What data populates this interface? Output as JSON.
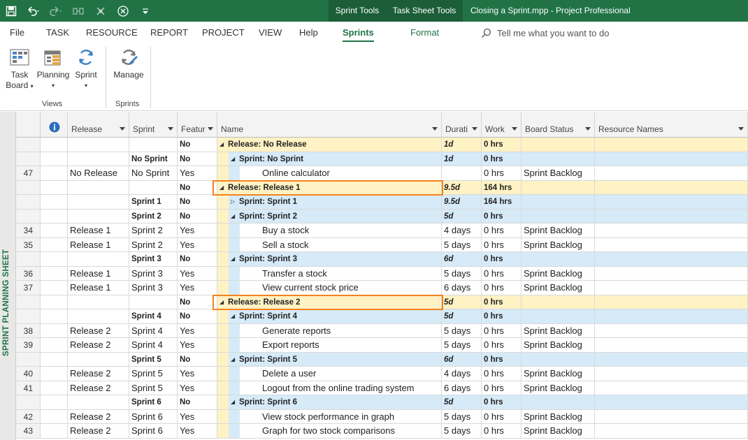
{
  "qat": {
    "icons": [
      "save-icon",
      "undo-icon",
      "redo-icon",
      "link-icon",
      "unlink-icon",
      "inspect-icon",
      "customize-icon"
    ]
  },
  "title_bar": {
    "context_tab_sprint": "Sprint Tools",
    "context_tab_tasksheet": "Task Sheet Tools",
    "title": "Closing a Sprint.mpp  -  Project Professional"
  },
  "menu": {
    "file": "File",
    "task": "TASK",
    "resource": "RESOURCE",
    "report": "REPORT",
    "project": "PROJECT",
    "view": "VIEW",
    "help": "Help",
    "sprints": "Sprints",
    "format": "Format",
    "tell_me": "Tell me what you want to do"
  },
  "ribbon": {
    "task_board_line1": "Task",
    "task_board_line2": "Board",
    "planning": "Planning",
    "sprint": "Sprint",
    "manage": "Manage",
    "group_views": "Views",
    "group_sprints": "Sprints"
  },
  "sidebar_label": "SPRINT PLANNING SHEET",
  "columns": [
    "Release",
    "Sprint",
    "Featur",
    "Name",
    "Durati",
    "Work",
    "Board Status",
    "Resource Names"
  ],
  "rows": [
    {
      "id": "",
      "release": "",
      "sprint": "",
      "feature": "No",
      "name": "Release: No Release",
      "duration": "1d",
      "work": "0 hrs",
      "status": "",
      "level": 0,
      "type": "release"
    },
    {
      "id": "",
      "release": "",
      "sprint": "No Sprint",
      "feature": "No",
      "name": "Sprint: No Sprint",
      "duration": "1d",
      "work": "0 hrs",
      "status": "",
      "level": 1,
      "type": "sprint"
    },
    {
      "id": "47",
      "release": "No Release",
      "sprint": "No Sprint",
      "feature": "Yes",
      "name": "Online calculator",
      "duration": "",
      "work": "0 hrs",
      "status": "Sprint Backlog",
      "level": 2,
      "type": "task"
    },
    {
      "id": "",
      "release": "",
      "sprint": "",
      "feature": "No",
      "name": "Release: Release 1",
      "duration": "9.5d",
      "work": "164 hrs",
      "status": "",
      "level": 0,
      "type": "release"
    },
    {
      "id": "",
      "release": "",
      "sprint": "Sprint 1",
      "feature": "No",
      "name": "Sprint: Sprint 1",
      "duration": "9.5d",
      "work": "164 hrs",
      "status": "",
      "level": 1,
      "type": "sprint",
      "collapsed": true
    },
    {
      "id": "",
      "release": "",
      "sprint": "Sprint 2",
      "feature": "No",
      "name": "Sprint: Sprint 2",
      "duration": "5d",
      "work": "0 hrs",
      "status": "",
      "level": 1,
      "type": "sprint"
    },
    {
      "id": "34",
      "release": "Release 1",
      "sprint": "Sprint 2",
      "feature": "Yes",
      "name": "Buy a stock",
      "duration": "4 days",
      "work": "0 hrs",
      "status": "Sprint Backlog",
      "level": 2,
      "type": "task"
    },
    {
      "id": "35",
      "release": "Release 1",
      "sprint": "Sprint 2",
      "feature": "Yes",
      "name": "Sell a stock",
      "duration": "5 days",
      "work": "0 hrs",
      "status": "Sprint Backlog",
      "level": 2,
      "type": "task"
    },
    {
      "id": "",
      "release": "",
      "sprint": "Sprint 3",
      "feature": "No",
      "name": "Sprint: Sprint 3",
      "duration": "6d",
      "work": "0 hrs",
      "status": "",
      "level": 1,
      "type": "sprint"
    },
    {
      "id": "36",
      "release": "Release 1",
      "sprint": "Sprint 3",
      "feature": "Yes",
      "name": "Transfer a stock",
      "duration": "5 days",
      "work": "0 hrs",
      "status": "Sprint Backlog",
      "level": 2,
      "type": "task"
    },
    {
      "id": "37",
      "release": "Release 1",
      "sprint": "Sprint 3",
      "feature": "Yes",
      "name": "View current stock price",
      "duration": "6 days",
      "work": "0 hrs",
      "status": "Sprint Backlog",
      "level": 2,
      "type": "task"
    },
    {
      "id": "",
      "release": "",
      "sprint": "",
      "feature": "No",
      "name": "Release: Release 2",
      "duration": "5d",
      "work": "0 hrs",
      "status": "",
      "level": 0,
      "type": "release"
    },
    {
      "id": "",
      "release": "",
      "sprint": "Sprint 4",
      "feature": "No",
      "name": "Sprint: Sprint 4",
      "duration": "5d",
      "work": "0 hrs",
      "status": "",
      "level": 1,
      "type": "sprint"
    },
    {
      "id": "38",
      "release": "Release 2",
      "sprint": "Sprint 4",
      "feature": "Yes",
      "name": "Generate reports",
      "duration": "5 days",
      "work": "0 hrs",
      "status": "Sprint Backlog",
      "level": 2,
      "type": "task"
    },
    {
      "id": "39",
      "release": "Release 2",
      "sprint": "Sprint 4",
      "feature": "Yes",
      "name": "Export reports",
      "duration": "5 days",
      "work": "0 hrs",
      "status": "Sprint Backlog",
      "level": 2,
      "type": "task"
    },
    {
      "id": "",
      "release": "",
      "sprint": "Sprint 5",
      "feature": "No",
      "name": "Sprint: Sprint 5",
      "duration": "6d",
      "work": "0 hrs",
      "status": "",
      "level": 1,
      "type": "sprint"
    },
    {
      "id": "40",
      "release": "Release 2",
      "sprint": "Sprint 5",
      "feature": "Yes",
      "name": "Delete a user",
      "duration": "4 days",
      "work": "0 hrs",
      "status": "Sprint Backlog",
      "level": 2,
      "type": "task"
    },
    {
      "id": "41",
      "release": "Release 2",
      "sprint": "Sprint 5",
      "feature": "Yes",
      "name": "Logout from the online trading system",
      "duration": "6 days",
      "work": "0 hrs",
      "status": "Sprint Backlog",
      "level": 2,
      "type": "task"
    },
    {
      "id": "",
      "release": "",
      "sprint": "Sprint 6",
      "feature": "No",
      "name": "Sprint: Sprint 6",
      "duration": "5d",
      "work": "0 hrs",
      "status": "",
      "level": 1,
      "type": "sprint"
    },
    {
      "id": "42",
      "release": "Release 2",
      "sprint": "Sprint 6",
      "feature": "Yes",
      "name": "View stock performance in graph",
      "duration": "5 days",
      "work": "0 hrs",
      "status": "Sprint Backlog",
      "level": 2,
      "type": "task"
    },
    {
      "id": "43",
      "release": "Release 2",
      "sprint": "Sprint 6",
      "feature": "Yes",
      "name": "Graph for two stock comparisons",
      "duration": "5 days",
      "work": "0 hrs",
      "status": "Sprint Backlog",
      "level": 2,
      "type": "task"
    }
  ],
  "highlighted_rows": [
    3,
    11
  ],
  "colors": {
    "brand": "#217346",
    "release_row": "#fff2c4",
    "sprint_row": "#d6eaf8",
    "release_indent": "#fff2c4",
    "sprint_indent": "#d6eaf8",
    "highlight_box": "#f58220"
  }
}
